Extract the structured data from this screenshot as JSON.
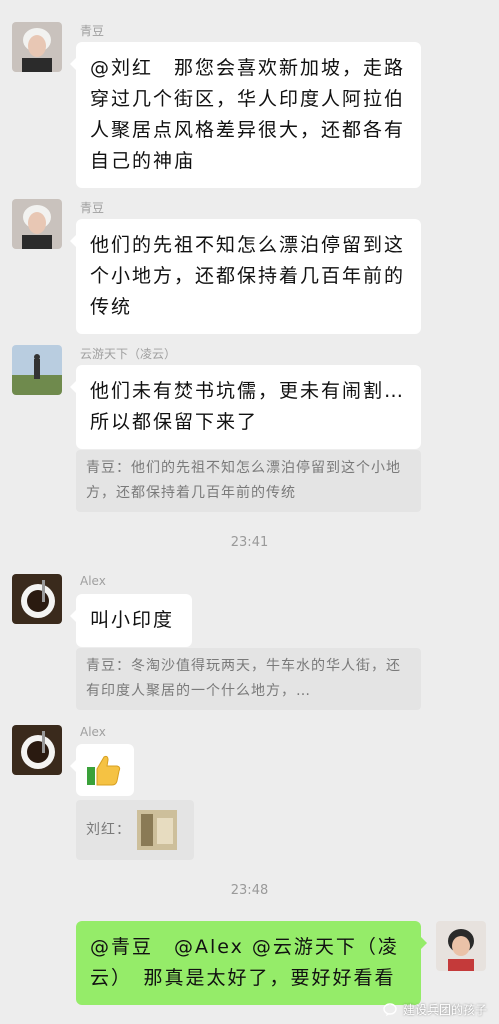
{
  "messages": [
    {
      "sender": "青豆",
      "text": "@刘红　那您会喜欢新加坡，走路穿过几个街区，华人印度人阿拉伯人聚居点风格差异很大，还都各有自己的神庙"
    },
    {
      "sender": "青豆",
      "text": "他们的先祖不知怎么漂泊停留到这个小地方，还都保持着几百年前的传统"
    },
    {
      "sender": "云游天下（凌云）",
      "text": "他们未有焚书坑儒，更未有闹割…所以都保留下来了",
      "quote": "青豆：他们的先祖不知怎么漂泊停留到这个小地方，还都保持着几百年前的传统"
    },
    {
      "sender": "Alex",
      "text": "叫小印度",
      "quote": "青豆：冬淘沙值得玩两天，牛车水的华人街，还有印度人聚居的一个什么地方，…"
    },
    {
      "sender": "Alex",
      "quote": "刘红："
    },
    {
      "text": "@青豆　@Alex @云游天下（凌云）　那真是太好了，要好好看看"
    }
  ],
  "times": [
    "23:41",
    "23:48"
  ],
  "watermark": "建设兵团的孩子",
  "icons": {
    "thumbs_up": "thumbs-up-emoji",
    "watermark": "wechat-official-icon"
  },
  "colors": {
    "background": "#ededed",
    "bubble": "#ffffff",
    "self_bubble": "#95ec69",
    "quote": "#e4e4e4"
  }
}
